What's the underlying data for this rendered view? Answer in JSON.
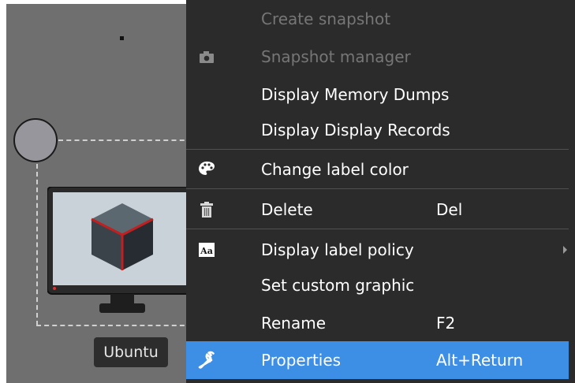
{
  "canvas": {
    "node_label": "Ubuntu"
  },
  "context_menu": {
    "items": [
      {
        "label": "Create snapshot",
        "enabled": false,
        "icon": null
      },
      {
        "label": "Snapshot manager",
        "enabled": false,
        "icon": "camera-icon"
      },
      {
        "label": "Display Memory Dumps",
        "enabled": true,
        "icon": null
      },
      {
        "label": "Display Display Records",
        "enabled": true,
        "icon": null
      },
      {
        "label": "Change label color",
        "enabled": true,
        "icon": "palette-icon"
      },
      {
        "label": "Delete",
        "shortcut": "Del",
        "enabled": true,
        "icon": "trash-icon"
      },
      {
        "label": "Display label policy",
        "enabled": true,
        "icon": "font-icon",
        "has_submenu": true
      },
      {
        "label": "Set custom graphic",
        "enabled": true,
        "icon": null
      },
      {
        "label": "Rename",
        "shortcut": "F2",
        "enabled": true,
        "icon": null
      },
      {
        "label": "Properties",
        "shortcut": "Alt+Return",
        "enabled": true,
        "icon": "wrench-icon",
        "highlighted": true
      }
    ],
    "colors": {
      "background": "#2b2b2b",
      "highlight": "#3d8ee5",
      "disabled_text": "#767676"
    }
  }
}
